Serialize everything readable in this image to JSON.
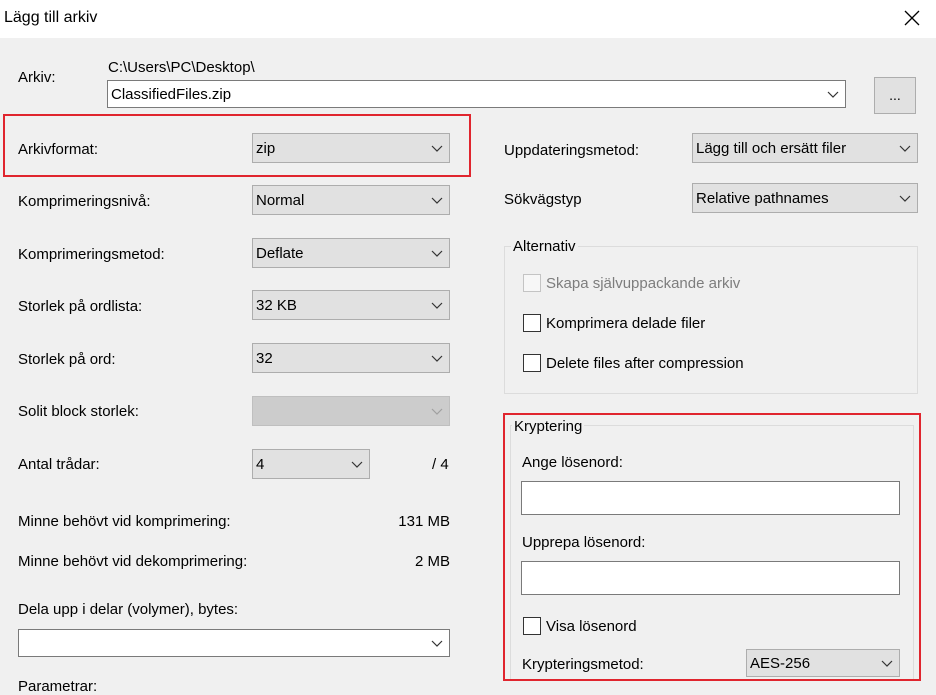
{
  "window": {
    "title": "Lägg till arkiv"
  },
  "archive": {
    "label": "Arkiv:",
    "path": "C:\\Users\\PC\\Desktop\\",
    "filename": "ClassifiedFiles.zip",
    "browse_label": "..."
  },
  "left": {
    "format_label": "Arkivformat:",
    "format_value": "zip",
    "level_label": "Komprimeringsnivå:",
    "level_value": "Normal",
    "method_label": "Komprimeringsmetod:",
    "method_value": "Deflate",
    "dict_label": "Storlek på ordlista:",
    "dict_value": "32 KB",
    "word_label": "Storlek på ord:",
    "word_value": "32",
    "solid_label": "Solit block storlek:",
    "solid_value": "",
    "threads_label": "Antal trådar:",
    "threads_value": "4",
    "threads_max": "/ 4",
    "mem_comp_label": "Minne behövt vid komprimering:",
    "mem_comp_value": "131 MB",
    "mem_decomp_label": "Minne behövt vid dekomprimering:",
    "mem_decomp_value": "2 MB",
    "split_label": "Dela upp i delar (volymer), bytes:",
    "split_value": "",
    "params_label": "Parametrar:"
  },
  "right": {
    "update_label": "Uppdateringsmetod:",
    "update_value": "Lägg till och ersätt filer",
    "pathmode_label": "Sökvägstyp",
    "pathmode_value": "Relative pathnames",
    "options": {
      "title": "Alternativ",
      "sfx_label": "Skapa självuppackande arkiv",
      "shared_label": "Komprimera delade filer",
      "delete_label": "Delete files after compression"
    },
    "encryption": {
      "title": "Kryptering",
      "password_label": "Ange lösenord:",
      "repeat_label": "Upprepa lösenord:",
      "show_label": "Visa lösenord",
      "method_label": "Krypteringsmetod:",
      "method_value": "AES-256"
    }
  },
  "colors": {
    "highlight": "#e0252e",
    "dialog_bg": "#f0f0f0"
  }
}
